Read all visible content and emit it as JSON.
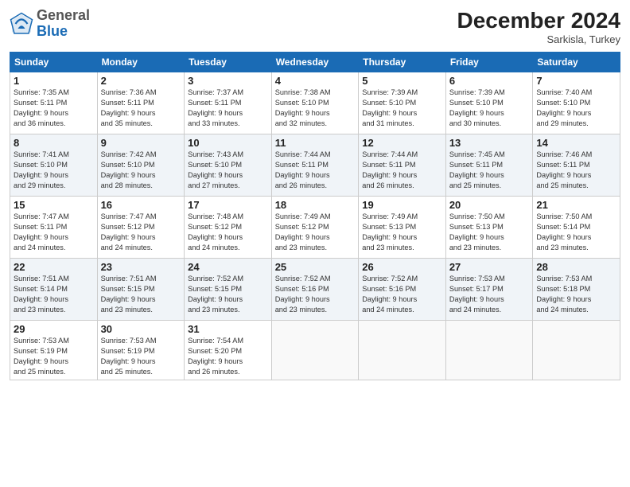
{
  "header": {
    "logo_general": "General",
    "logo_blue": "Blue",
    "month_title": "December 2024",
    "location": "Sarkisla, Turkey"
  },
  "days_of_week": [
    "Sunday",
    "Monday",
    "Tuesday",
    "Wednesday",
    "Thursday",
    "Friday",
    "Saturday"
  ],
  "weeks": [
    [
      {
        "day": "1",
        "sunrise": "Sunrise: 7:35 AM",
        "sunset": "Sunset: 5:11 PM",
        "daylight": "Daylight: 9 hours and 36 minutes."
      },
      {
        "day": "2",
        "sunrise": "Sunrise: 7:36 AM",
        "sunset": "Sunset: 5:11 PM",
        "daylight": "Daylight: 9 hours and 35 minutes."
      },
      {
        "day": "3",
        "sunrise": "Sunrise: 7:37 AM",
        "sunset": "Sunset: 5:11 PM",
        "daylight": "Daylight: 9 hours and 33 minutes."
      },
      {
        "day": "4",
        "sunrise": "Sunrise: 7:38 AM",
        "sunset": "Sunset: 5:10 PM",
        "daylight": "Daylight: 9 hours and 32 minutes."
      },
      {
        "day": "5",
        "sunrise": "Sunrise: 7:39 AM",
        "sunset": "Sunset: 5:10 PM",
        "daylight": "Daylight: 9 hours and 31 minutes."
      },
      {
        "day": "6",
        "sunrise": "Sunrise: 7:39 AM",
        "sunset": "Sunset: 5:10 PM",
        "daylight": "Daylight: 9 hours and 30 minutes."
      },
      {
        "day": "7",
        "sunrise": "Sunrise: 7:40 AM",
        "sunset": "Sunset: 5:10 PM",
        "daylight": "Daylight: 9 hours and 29 minutes."
      }
    ],
    [
      {
        "day": "8",
        "sunrise": "Sunrise: 7:41 AM",
        "sunset": "Sunset: 5:10 PM",
        "daylight": "Daylight: 9 hours and 29 minutes."
      },
      {
        "day": "9",
        "sunrise": "Sunrise: 7:42 AM",
        "sunset": "Sunset: 5:10 PM",
        "daylight": "Daylight: 9 hours and 28 minutes."
      },
      {
        "day": "10",
        "sunrise": "Sunrise: 7:43 AM",
        "sunset": "Sunset: 5:10 PM",
        "daylight": "Daylight: 9 hours and 27 minutes."
      },
      {
        "day": "11",
        "sunrise": "Sunrise: 7:44 AM",
        "sunset": "Sunset: 5:11 PM",
        "daylight": "Daylight: 9 hours and 26 minutes."
      },
      {
        "day": "12",
        "sunrise": "Sunrise: 7:44 AM",
        "sunset": "Sunset: 5:11 PM",
        "daylight": "Daylight: 9 hours and 26 minutes."
      },
      {
        "day": "13",
        "sunrise": "Sunrise: 7:45 AM",
        "sunset": "Sunset: 5:11 PM",
        "daylight": "Daylight: 9 hours and 25 minutes."
      },
      {
        "day": "14",
        "sunrise": "Sunrise: 7:46 AM",
        "sunset": "Sunset: 5:11 PM",
        "daylight": "Daylight: 9 hours and 25 minutes."
      }
    ],
    [
      {
        "day": "15",
        "sunrise": "Sunrise: 7:47 AM",
        "sunset": "Sunset: 5:11 PM",
        "daylight": "Daylight: 9 hours and 24 minutes."
      },
      {
        "day": "16",
        "sunrise": "Sunrise: 7:47 AM",
        "sunset": "Sunset: 5:12 PM",
        "daylight": "Daylight: 9 hours and 24 minutes."
      },
      {
        "day": "17",
        "sunrise": "Sunrise: 7:48 AM",
        "sunset": "Sunset: 5:12 PM",
        "daylight": "Daylight: 9 hours and 24 minutes."
      },
      {
        "day": "18",
        "sunrise": "Sunrise: 7:49 AM",
        "sunset": "Sunset: 5:12 PM",
        "daylight": "Daylight: 9 hours and 23 minutes."
      },
      {
        "day": "19",
        "sunrise": "Sunrise: 7:49 AM",
        "sunset": "Sunset: 5:13 PM",
        "daylight": "Daylight: 9 hours and 23 minutes."
      },
      {
        "day": "20",
        "sunrise": "Sunrise: 7:50 AM",
        "sunset": "Sunset: 5:13 PM",
        "daylight": "Daylight: 9 hours and 23 minutes."
      },
      {
        "day": "21",
        "sunrise": "Sunrise: 7:50 AM",
        "sunset": "Sunset: 5:14 PM",
        "daylight": "Daylight: 9 hours and 23 minutes."
      }
    ],
    [
      {
        "day": "22",
        "sunrise": "Sunrise: 7:51 AM",
        "sunset": "Sunset: 5:14 PM",
        "daylight": "Daylight: 9 hours and 23 minutes."
      },
      {
        "day": "23",
        "sunrise": "Sunrise: 7:51 AM",
        "sunset": "Sunset: 5:15 PM",
        "daylight": "Daylight: 9 hours and 23 minutes."
      },
      {
        "day": "24",
        "sunrise": "Sunrise: 7:52 AM",
        "sunset": "Sunset: 5:15 PM",
        "daylight": "Daylight: 9 hours and 23 minutes."
      },
      {
        "day": "25",
        "sunrise": "Sunrise: 7:52 AM",
        "sunset": "Sunset: 5:16 PM",
        "daylight": "Daylight: 9 hours and 23 minutes."
      },
      {
        "day": "26",
        "sunrise": "Sunrise: 7:52 AM",
        "sunset": "Sunset: 5:16 PM",
        "daylight": "Daylight: 9 hours and 24 minutes."
      },
      {
        "day": "27",
        "sunrise": "Sunrise: 7:53 AM",
        "sunset": "Sunset: 5:17 PM",
        "daylight": "Daylight: 9 hours and 24 minutes."
      },
      {
        "day": "28",
        "sunrise": "Sunrise: 7:53 AM",
        "sunset": "Sunset: 5:18 PM",
        "daylight": "Daylight: 9 hours and 24 minutes."
      }
    ],
    [
      {
        "day": "29",
        "sunrise": "Sunrise: 7:53 AM",
        "sunset": "Sunset: 5:19 PM",
        "daylight": "Daylight: 9 hours and 25 minutes."
      },
      {
        "day": "30",
        "sunrise": "Sunrise: 7:53 AM",
        "sunset": "Sunset: 5:19 PM",
        "daylight": "Daylight: 9 hours and 25 minutes."
      },
      {
        "day": "31",
        "sunrise": "Sunrise: 7:54 AM",
        "sunset": "Sunset: 5:20 PM",
        "daylight": "Daylight: 9 hours and 26 minutes."
      },
      {
        "day": "",
        "sunrise": "",
        "sunset": "",
        "daylight": ""
      },
      {
        "day": "",
        "sunrise": "",
        "sunset": "",
        "daylight": ""
      },
      {
        "day": "",
        "sunrise": "",
        "sunset": "",
        "daylight": ""
      },
      {
        "day": "",
        "sunrise": "",
        "sunset": "",
        "daylight": ""
      }
    ]
  ]
}
